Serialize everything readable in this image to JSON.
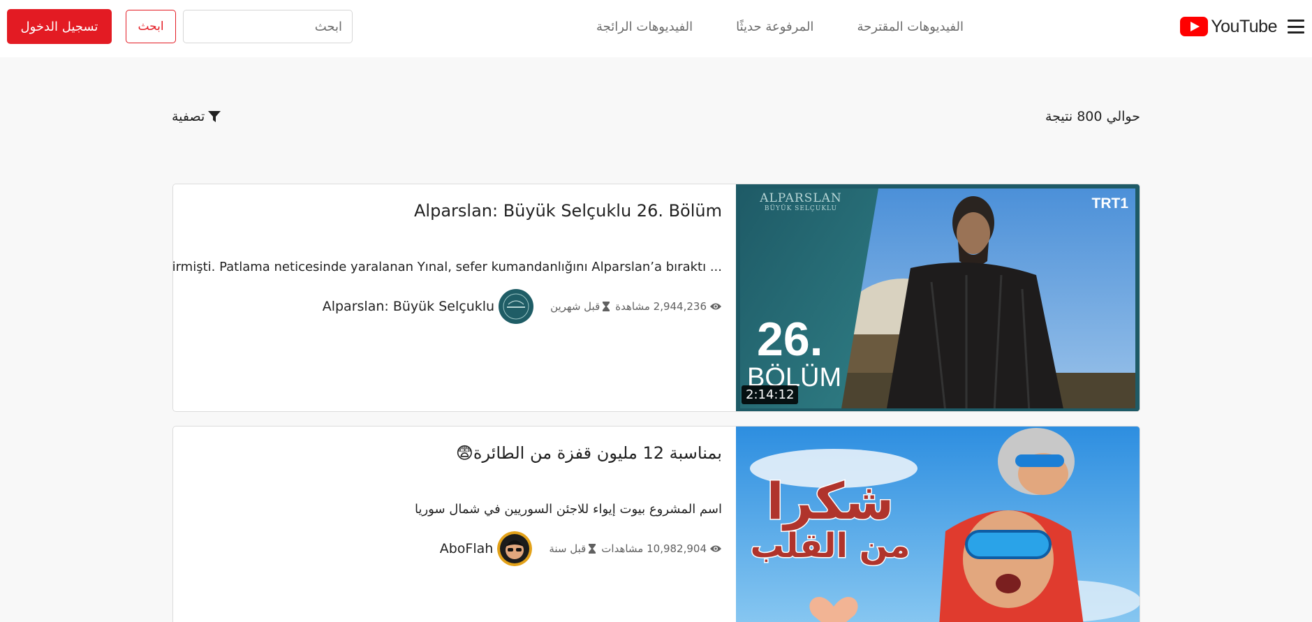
{
  "header": {
    "logo_text": "YouTube",
    "nav": [
      "الفيديوهات المقترحة",
      "المرفوعة حديثًا",
      "الفيديوهات الرائجة"
    ],
    "search_placeholder": "ابحث",
    "search_button": "ابحث",
    "login_button": "تسجيل الدخول"
  },
  "results": {
    "count_text": "حوالي 800 نتيجة",
    "filter_label": "تصفية"
  },
  "videos": [
    {
      "title": "Alparslan: Büyük Selçuklu 26. Bölüm",
      "description": "... getirmişti. Patlama neticesinde yaralanan Yınal, sefer kumandanlığını Alparslan’a bıraktı",
      "views": "2,944,236 مشاهدة",
      "age": "قبل شهرين",
      "channel": "Alparslan: Büyük Selçuklu",
      "duration": "2:14:12",
      "thumb_brand": "TRT1",
      "thumb_caption_number": "26.",
      "thumb_caption_word": "BÖLÜM",
      "thumb_logo_line1": "ALPARSLAN",
      "thumb_logo_line2": "BÜYÜK SELÇUKLU"
    },
    {
      "title": "بمناسبة 12 مليون قفزة من الطائرة😨",
      "description": "اسم المشروع بيوت إيواء للاجئن السوريين في شمال سوريا",
      "views": "10,982,904 مشاهدات",
      "age": "قبل سنة",
      "channel": "AboFlah",
      "thumb_text_line1": "شكرا",
      "thumb_text_line2": "من القلب"
    }
  ],
  "colors": {
    "accent": "#e31b23",
    "youtube_red": "#ff0000",
    "page_bg": "#f8f8f8"
  },
  "icons": [
    "menu-icon",
    "youtube-logo-icon",
    "filter-icon",
    "eye-icon",
    "hourglass-icon"
  ]
}
